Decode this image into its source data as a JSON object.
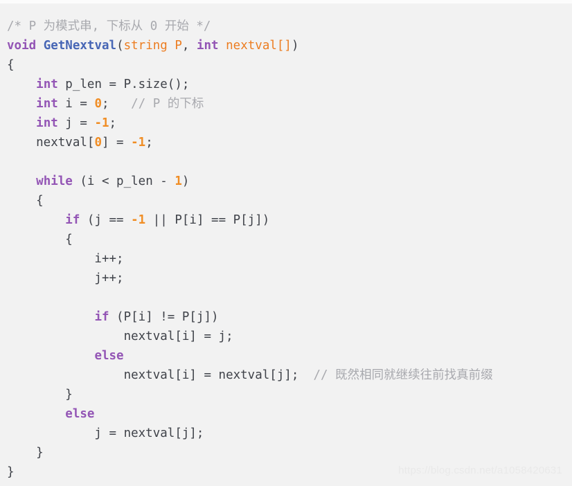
{
  "editor": {
    "language": "cpp",
    "background_color": "#f2f2f2",
    "default_text_color": "#383a42",
    "colors": {
      "keyword": "#9355b5",
      "function": "#4766b5",
      "parameter": "#ec7d21",
      "number": "#f08d24",
      "comment": "#a8a9ae",
      "plain": "#3f4249",
      "watermark": "#e9e9e9"
    }
  },
  "watermark": {
    "text": "https://blog.csdn.net/a1058420631"
  },
  "code": {
    "full_text": "/* P 为模式串, 下标从 0 开始 */\nvoid GetNextval(string P, int nextval[])\n{\n    int p_len = P.size();\n    int i = 0;   // P 的下标\n    int j = -1;\n    nextval[0] = -1;\n\n    while (i < p_len - 1)\n    {\n        if (j == -1 || P[i] == P[j])\n        {\n            i++;\n            j++;\n\n            if (P[i] != P[j])\n                nextval[i] = j;\n            else\n                nextval[i] = nextval[j];  // 既然相同就继续往前找真前缀\n        }\n        else\n            j = nextval[j];\n    }\n}",
    "lines": [
      {
        "n": 1,
        "tokens": [
          {
            "t": "comment",
            "v": "/* P 为模式串, 下标从 0 开始 */"
          }
        ]
      },
      {
        "n": 2,
        "tokens": [
          {
            "t": "kw",
            "v": "void"
          },
          {
            "t": "plain",
            "v": " "
          },
          {
            "t": "fn",
            "v": "GetNextval"
          },
          {
            "t": "plain",
            "v": "("
          },
          {
            "t": "param",
            "v": "string P"
          },
          {
            "t": "plain",
            "v": ", "
          },
          {
            "t": "kw",
            "v": "int"
          },
          {
            "t": "plain",
            "v": " "
          },
          {
            "t": "param",
            "v": "nextval[]"
          },
          {
            "t": "plain",
            "v": ")"
          }
        ]
      },
      {
        "n": 3,
        "tokens": [
          {
            "t": "plain",
            "v": "{"
          }
        ]
      },
      {
        "n": 4,
        "tokens": [
          {
            "t": "plain",
            "v": "    "
          },
          {
            "t": "kw",
            "v": "int"
          },
          {
            "t": "plain",
            "v": " p_len = P.size();"
          }
        ]
      },
      {
        "n": 5,
        "tokens": [
          {
            "t": "plain",
            "v": "    "
          },
          {
            "t": "kw",
            "v": "int"
          },
          {
            "t": "plain",
            "v": " i = "
          },
          {
            "t": "num",
            "v": "0"
          },
          {
            "t": "plain",
            "v": ";   "
          },
          {
            "t": "comment",
            "v": "// P 的下标"
          }
        ]
      },
      {
        "n": 6,
        "tokens": [
          {
            "t": "plain",
            "v": "    "
          },
          {
            "t": "kw",
            "v": "int"
          },
          {
            "t": "plain",
            "v": " j = "
          },
          {
            "t": "num",
            "v": "-1"
          },
          {
            "t": "plain",
            "v": ";"
          }
        ]
      },
      {
        "n": 7,
        "tokens": [
          {
            "t": "plain",
            "v": "    nextval["
          },
          {
            "t": "num",
            "v": "0"
          },
          {
            "t": "plain",
            "v": "] = "
          },
          {
            "t": "num",
            "v": "-1"
          },
          {
            "t": "plain",
            "v": ";"
          }
        ]
      },
      {
        "n": 8,
        "tokens": [
          {
            "t": "plain",
            "v": ""
          }
        ]
      },
      {
        "n": 9,
        "tokens": [
          {
            "t": "plain",
            "v": "    "
          },
          {
            "t": "kw",
            "v": "while"
          },
          {
            "t": "plain",
            "v": " (i < p_len - "
          },
          {
            "t": "num",
            "v": "1"
          },
          {
            "t": "plain",
            "v": ")"
          }
        ]
      },
      {
        "n": 10,
        "tokens": [
          {
            "t": "plain",
            "v": "    {"
          }
        ]
      },
      {
        "n": 11,
        "tokens": [
          {
            "t": "plain",
            "v": "        "
          },
          {
            "t": "kw",
            "v": "if"
          },
          {
            "t": "plain",
            "v": " (j == "
          },
          {
            "t": "num",
            "v": "-1"
          },
          {
            "t": "plain",
            "v": " || P[i] == P[j])"
          }
        ]
      },
      {
        "n": 12,
        "tokens": [
          {
            "t": "plain",
            "v": "        {"
          }
        ]
      },
      {
        "n": 13,
        "tokens": [
          {
            "t": "plain",
            "v": "            i++;"
          }
        ]
      },
      {
        "n": 14,
        "tokens": [
          {
            "t": "plain",
            "v": "            j++;"
          }
        ]
      },
      {
        "n": 15,
        "tokens": [
          {
            "t": "plain",
            "v": ""
          }
        ]
      },
      {
        "n": 16,
        "tokens": [
          {
            "t": "plain",
            "v": "            "
          },
          {
            "t": "kw",
            "v": "if"
          },
          {
            "t": "plain",
            "v": " (P[i] != P[j])"
          }
        ]
      },
      {
        "n": 17,
        "tokens": [
          {
            "t": "plain",
            "v": "                nextval[i] = j;"
          }
        ]
      },
      {
        "n": 18,
        "tokens": [
          {
            "t": "plain",
            "v": "            "
          },
          {
            "t": "kw",
            "v": "else"
          }
        ]
      },
      {
        "n": 19,
        "tokens": [
          {
            "t": "plain",
            "v": "                nextval[i] = nextval[j];  "
          },
          {
            "t": "comment",
            "v": "// 既然相同就继续往前找真前缀"
          }
        ]
      },
      {
        "n": 20,
        "tokens": [
          {
            "t": "plain",
            "v": "        }"
          }
        ]
      },
      {
        "n": 21,
        "tokens": [
          {
            "t": "plain",
            "v": "        "
          },
          {
            "t": "kw",
            "v": "else"
          }
        ]
      },
      {
        "n": 22,
        "tokens": [
          {
            "t": "plain",
            "v": "            j = nextval[j];"
          }
        ]
      },
      {
        "n": 23,
        "tokens": [
          {
            "t": "plain",
            "v": "    }"
          }
        ]
      },
      {
        "n": 24,
        "tokens": [
          {
            "t": "plain",
            "v": "}"
          }
        ]
      }
    ]
  }
}
